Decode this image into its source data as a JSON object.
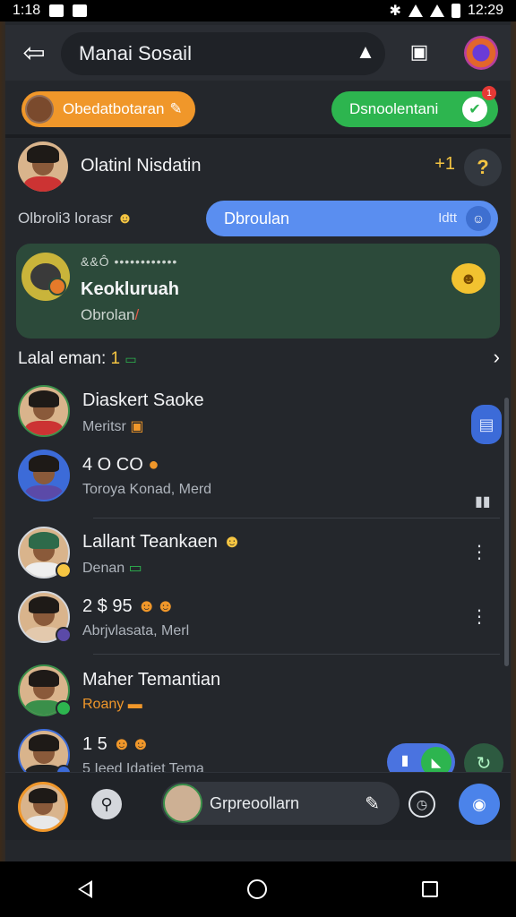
{
  "status": {
    "time_left": "1:18",
    "time_right": "12:29"
  },
  "app_bar": {
    "title": "Manai Sosail"
  },
  "chips": {
    "left_label": "Obedatbotaran",
    "right_label": "Dsnoolentani",
    "right_badge": "1"
  },
  "top_person": {
    "name": "Olatinl Nisdatin",
    "count": "+1",
    "action_symbol": "?"
  },
  "filter": {
    "label": "Olbroli3 lorasr",
    "search_value": "Dbroulan",
    "search_tail": "Idtt"
  },
  "featured": {
    "meta": "&&Ô ••••••••••••",
    "title": "Keokluruah",
    "subtitle": "Obrolan"
  },
  "section": {
    "label": "Lalal eman: ",
    "count": "1"
  },
  "items": [
    {
      "name": "Diaskert Saoke",
      "sub": "Meritsr"
    },
    {
      "name": "4 O CO",
      "sub": "Toroya Konad, Merd"
    },
    {
      "name": "Lallant Teankaen",
      "sub": "Denan"
    },
    {
      "name": "2 $ 95",
      "sub": "Abrjvlasata, Merl"
    },
    {
      "name": "Maher Temantian",
      "sub": "Roany"
    },
    {
      "name": "1 5",
      "sub": "5  Ieed Idatiet Tema"
    }
  ],
  "bottom": {
    "pill_label": "Grpreoollarn"
  },
  "colors": {
    "accent_orange": "#f0972a",
    "accent_green": "#2db54f",
    "accent_blue": "#5a8ef0"
  }
}
